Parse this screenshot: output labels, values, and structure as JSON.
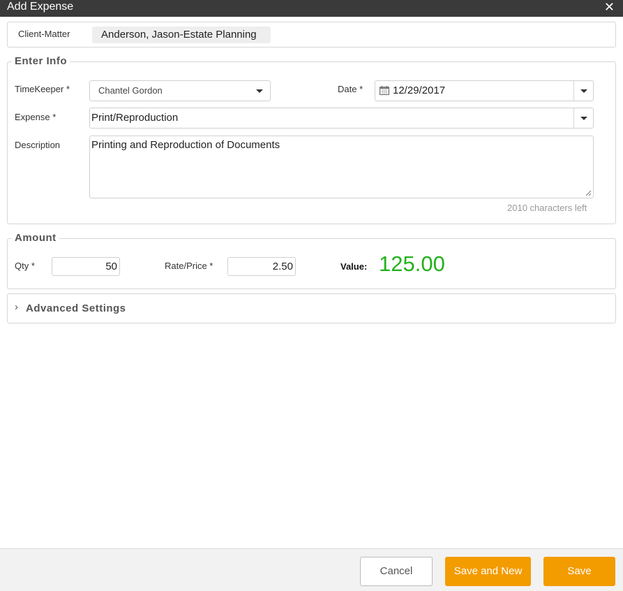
{
  "dialog": {
    "title": "Add Expense",
    "close_icon": "close-icon"
  },
  "client_matter": {
    "label": "Client-Matter",
    "value": "Anderson, Jason-Estate Planning"
  },
  "enter_info": {
    "legend": "Enter Info",
    "timekeeper": {
      "label": "TimeKeeper *",
      "value": "Chantel Gordon"
    },
    "date": {
      "label": "Date *",
      "value": "12/29/2017",
      "icon": "calendar-icon"
    },
    "expense": {
      "label": "Expense *",
      "value": "Print/Reproduction"
    },
    "description": {
      "label": "Description",
      "value": "Printing and Reproduction of Documents",
      "chars_left": "2010 characters left"
    }
  },
  "amount": {
    "legend": "Amount",
    "qty": {
      "label": "Qty *",
      "value": "50"
    },
    "rate": {
      "label": "Rate/Price *",
      "value": "2.50"
    },
    "value_label": "Value:",
    "value": "125.00",
    "value_color": "#22b21a"
  },
  "advanced": {
    "label": "Advanced Settings",
    "icon": "chevron-right-icon"
  },
  "footer": {
    "cancel": "Cancel",
    "save_and_new": "Save and New",
    "save": "Save",
    "accent_color": "#f39c00"
  }
}
